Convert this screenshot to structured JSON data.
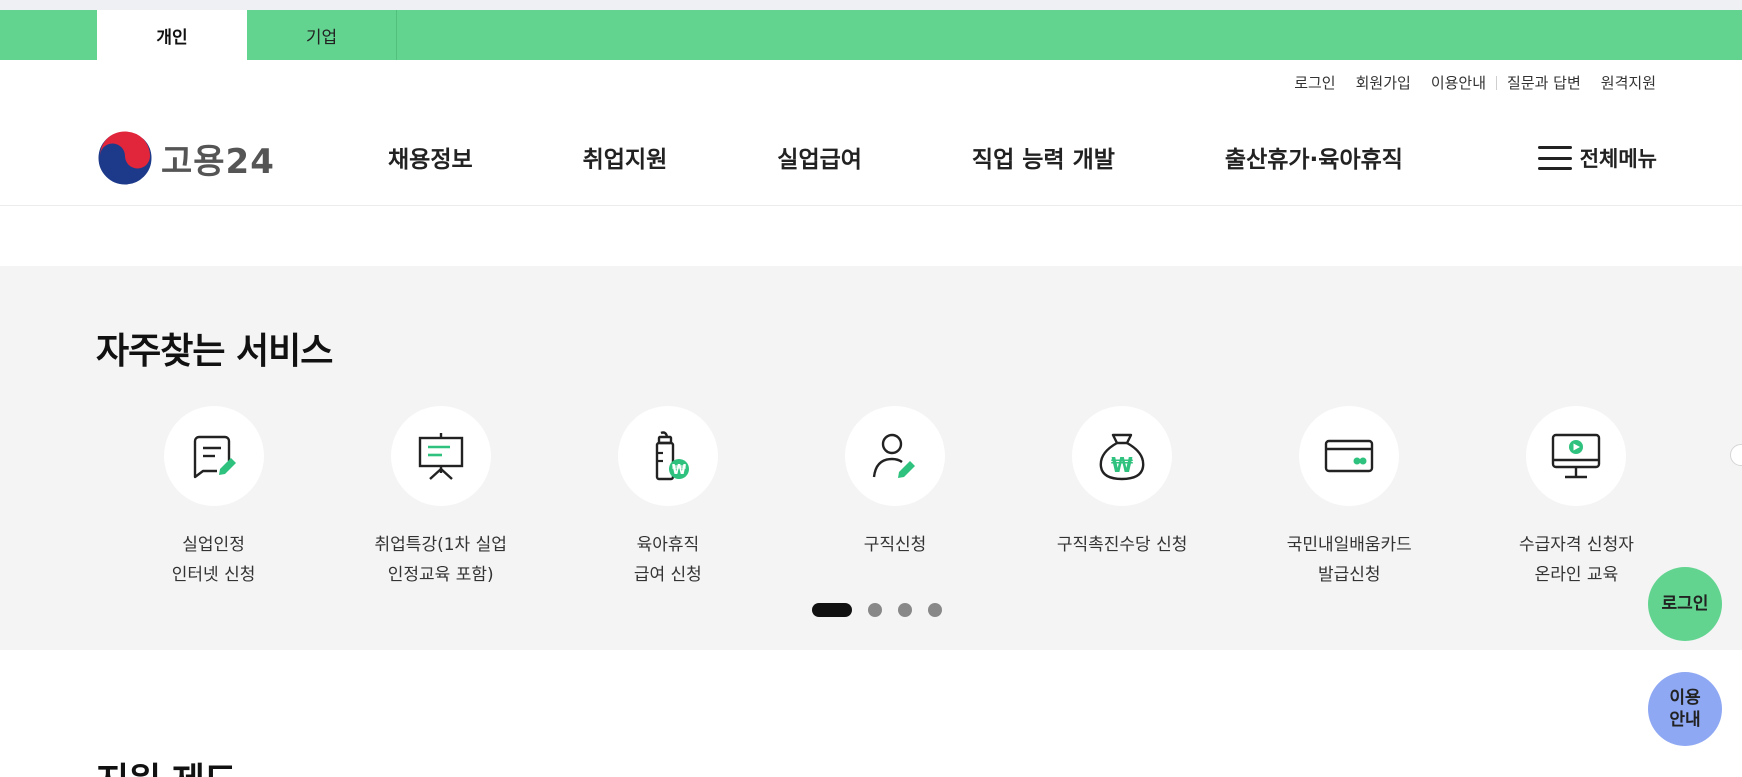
{
  "tabs": [
    {
      "label": "개인",
      "active": true
    },
    {
      "label": "기업",
      "active": false
    }
  ],
  "util_links": [
    "로그인",
    "회원가입",
    "이용안내",
    "질문과 답변",
    "원격지원"
  ],
  "logo": {
    "text": "고용24"
  },
  "gnb": [
    "채용정보",
    "취업지원",
    "실업급여",
    "직업 능력 개발",
    "출산휴가·육아휴직"
  ],
  "all_menu": {
    "label": "전체메뉴",
    "icon": "hamburger-icon"
  },
  "services": {
    "title": "자주찾는 서비스",
    "items": [
      {
        "label": "실업인정\n인터넷 신청",
        "icon": "document-edit-icon"
      },
      {
        "label": "취업특강(1차 실업\n인정교육 포함)",
        "icon": "presentation-board-icon"
      },
      {
        "label": "육아휴직\n급여 신청",
        "icon": "baby-bottle-won-icon"
      },
      {
        "label": "구직신청",
        "icon": "person-edit-icon"
      },
      {
        "label": "구직촉진수당 신청",
        "icon": "money-bag-won-icon"
      },
      {
        "label": "국민내일배움카드\n발급신청",
        "icon": "card-icon"
      },
      {
        "label": "수급자격 신청자\n온라인 교육",
        "icon": "monitor-play-icon"
      }
    ],
    "pagination": {
      "total": 4,
      "current": 1
    }
  },
  "floating": {
    "login": "로그인",
    "guide": "이용\n안내"
  },
  "next_section_title": "지원 제도",
  "colors": {
    "accent_green": "#62d490",
    "accent_blue": "#8fa8f3",
    "icon_green": "#2ec27e"
  }
}
